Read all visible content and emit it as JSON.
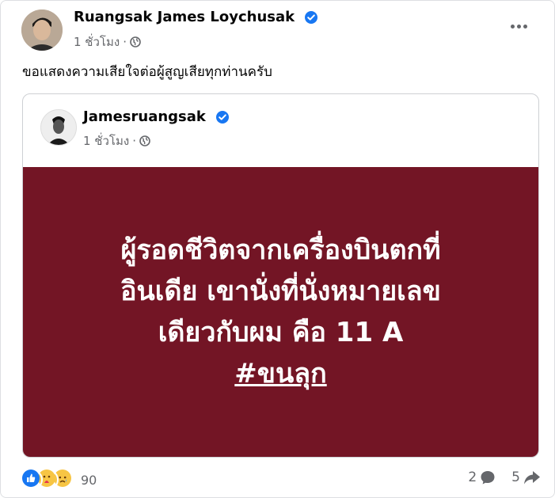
{
  "post": {
    "author": "Ruangsak James Loychusak",
    "time": "1 ชั่วโมง",
    "separator": "·",
    "text": "ขอแสดงความเสียใจต่อผู้สูญเสียทุกท่านครับ",
    "more_icon": "more-horizontal-icon"
  },
  "shared_post": {
    "author": "Jamesruangsak",
    "time": "1 ชั่วโมง",
    "separator": "·",
    "banner_lines": [
      "ผู้รอดชีวิตจากเครื่องบินตกที่",
      "อินเดีย เขานั่งที่นั่งหมายเลข",
      "เดียวกับผม คือ 11 A"
    ],
    "hashtag": "#ขนลุก",
    "banner_color": "#731525"
  },
  "footer": {
    "reaction_count": "90",
    "comment_count": "2",
    "share_count": "5"
  },
  "colors": {
    "verified": "#1877f2",
    "secondary_text": "#65676b"
  }
}
